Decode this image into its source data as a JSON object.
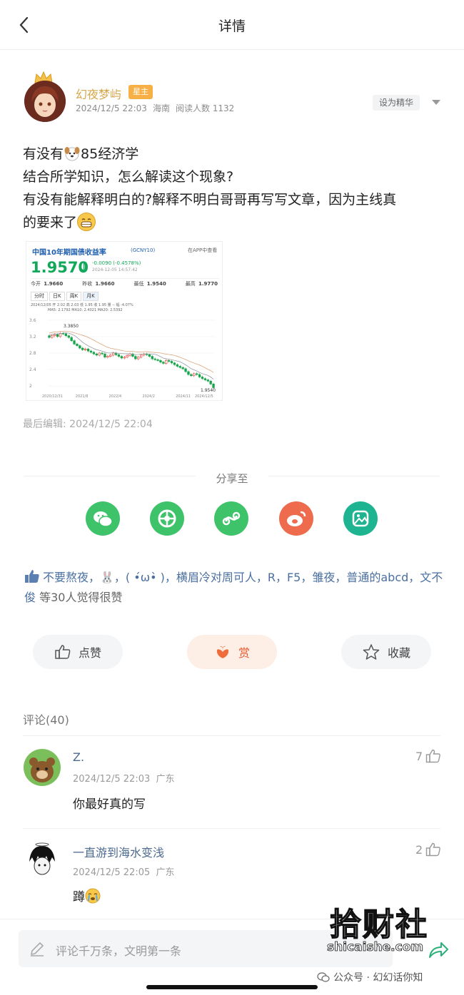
{
  "header": {
    "title": "详情"
  },
  "post": {
    "author": "幻夜梦屿",
    "author_badge": "星主",
    "date": "2024/12/5 22:03",
    "location": "海南",
    "reads": "阅读人数 1132",
    "set_featured": "设为精华",
    "lines": [
      {
        "before": "有没有",
        "after": "85经济学",
        "emoji": "dog-face"
      },
      {
        "text": "结合所学知识，怎么解读这个现象?"
      },
      {
        "text": "有没有能解释明白的?解释不明白哥哥再写写文章，因为主线真"
      },
      {
        "before": "的要来了",
        "emoji": "grin-face"
      }
    ],
    "edited": "最后编辑: 2024/12/5 22:04"
  },
  "chart_data": {
    "type": "candlestick",
    "title": "中国10年期国债收益率",
    "code": "(GCNY10)",
    "app_link": "在APP中查看",
    "price": "1.9570",
    "change": "-0.0090 (-0.4578%)",
    "time": "2024-12-05 14:57:42",
    "stats": [
      {
        "label": "今开",
        "value": "1.9660"
      },
      {
        "label": "昨收",
        "value": "1.9660"
      },
      {
        "label": "最低",
        "value": "1.9540"
      },
      {
        "label": "最高",
        "value": "1.9770"
      }
    ],
    "tabs": [
      "分时",
      "日K",
      "周K",
      "月K"
    ],
    "active_tab": "月K",
    "ma_line": "2024/12/05 开 2.02 高 2.03 低 1.95 收 1.95 量 -- 幅 -4.07%",
    "ma_values": "MA5: 2.1792  MA10: 2.4021  MA20: 2.5392",
    "y_ticks": [
      "3.6",
      "3.2",
      "2.8",
      "2.4",
      "2"
    ],
    "y_range": [
      1.9,
      3.7
    ],
    "high_label": "3.3850",
    "low_label": "1.9540",
    "x_ticks": [
      "2020/12/31",
      "2021/8",
      "2022/4",
      "2024/2",
      "2024/11",
      "2024/12/5"
    ],
    "closes": [
      3.18,
      3.22,
      3.25,
      3.2,
      3.28,
      3.27,
      3.22,
      3.18,
      3.1,
      3.02,
      2.98,
      2.92,
      2.88,
      2.9,
      2.85,
      2.82,
      2.78,
      2.75,
      2.8,
      2.78,
      2.7,
      2.72,
      2.75,
      2.8,
      2.76,
      2.72,
      2.68,
      2.7,
      2.74,
      2.78,
      2.72,
      2.66,
      2.7,
      2.75,
      2.78,
      2.76,
      2.72,
      2.66,
      2.64,
      2.62,
      2.58,
      2.55,
      2.62,
      2.6,
      2.56,
      2.52,
      2.48,
      2.45,
      2.42,
      2.35,
      2.28,
      2.25,
      2.3,
      2.28,
      2.22,
      2.18,
      2.15,
      2.12,
      2.05,
      1.96
    ]
  },
  "share": {
    "label": "分享至",
    "items": [
      "wechat-icon",
      "moments-icon",
      "miniprogram-icon",
      "weibo-icon",
      "qzone-icon"
    ],
    "colors": [
      "#3ec26a",
      "#3ec26a",
      "#3ec26a",
      "#ef6b4d",
      "#1fb491"
    ]
  },
  "likes": {
    "names": "不要熬夜，🐰，( •́ω•̀ )，横眉冷对周可人，R，F5，雏夜，普通的abcd，文不俊",
    "suffix": " 等30人觉得很赞"
  },
  "actions": {
    "like": "点赞",
    "reward": "赏",
    "favorite": "收藏"
  },
  "comments": {
    "title": "评论(40)",
    "items": [
      {
        "name": "Z.",
        "time": "2024/12/5 22:03",
        "location": "广东",
        "text": "你最好真的写",
        "likes": "7"
      },
      {
        "name": "一直游到海水变浅",
        "time": "2024/12/5 22:05",
        "location": "广东",
        "text": "蹲",
        "likes": "2"
      }
    ]
  },
  "composer": {
    "placeholder": "评论千万条，文明第一条"
  },
  "watermark": {
    "big": "拾财社",
    "url": "shicaishe.com",
    "account": "公众号 · 幻幻话你知"
  }
}
